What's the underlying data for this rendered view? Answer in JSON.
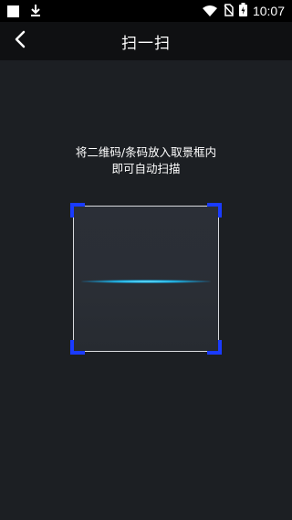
{
  "status_bar": {
    "time": "10:07",
    "icons": [
      "notification-square-icon",
      "download-icon",
      "wifi-icon",
      "no-sim-icon",
      "battery-charging-icon"
    ]
  },
  "toolbar": {
    "back_icon": "chevron-left-icon",
    "title": "扫一扫"
  },
  "scanner": {
    "hint_line1": "将二维码/条码放入取景框内",
    "hint_line2": "即可自动扫描",
    "corner_color": "#1a3bff",
    "scan_line_color": "#1fb4e6"
  }
}
